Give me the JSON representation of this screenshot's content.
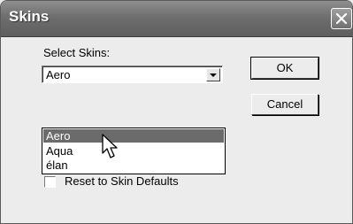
{
  "dialog": {
    "title": "Skins",
    "select_label": "Select Skins:",
    "combo_value": "Aero",
    "dropdown_options": [
      "Aero",
      "Aqua",
      "élan"
    ],
    "selected_option": "Aero",
    "checkbox_label": "Reset to Skin Defaults",
    "checkbox_checked": false,
    "ok_label": "OK",
    "cancel_label": "Cancel"
  },
  "colors": {
    "titlebar": "#6e6e6e",
    "highlight": "#6b6b6b",
    "face": "#ececec"
  },
  "icons": [
    "close-icon",
    "dropdown-arrow-icon",
    "mouse-pointer-icon"
  ]
}
